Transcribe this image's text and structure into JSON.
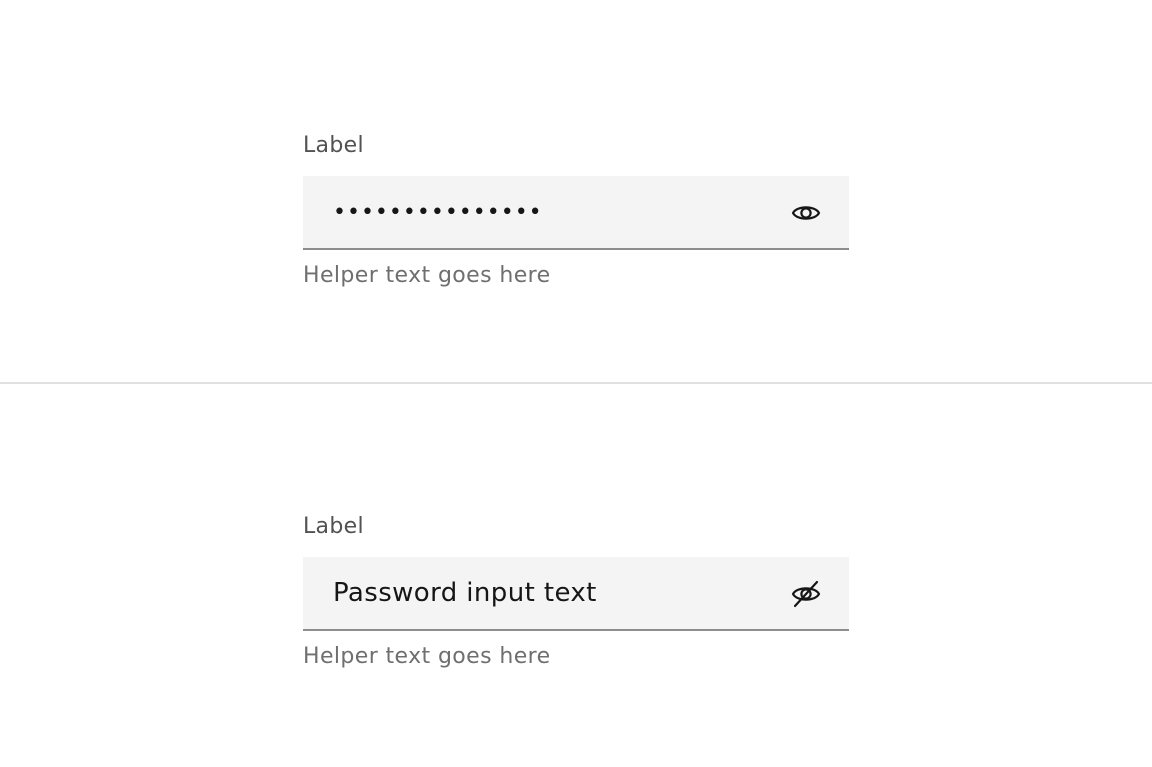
{
  "fields": [
    {
      "label": "Label",
      "value": "•••••••••••••••",
      "helper": "Helper text goes here",
      "toggle_icon": "eye-icon",
      "state": "hidden"
    },
    {
      "label": "Label",
      "value": "Password input text",
      "helper": "Helper text goes here",
      "toggle_icon": "eye-off-icon",
      "state": "visible"
    }
  ],
  "colors": {
    "field_background": "#f4f4f4",
    "field_border": "#8d8d8d",
    "label": "#525252",
    "helper": "#6f6f6f",
    "text": "#161616",
    "divider": "#e0e0e0"
  }
}
